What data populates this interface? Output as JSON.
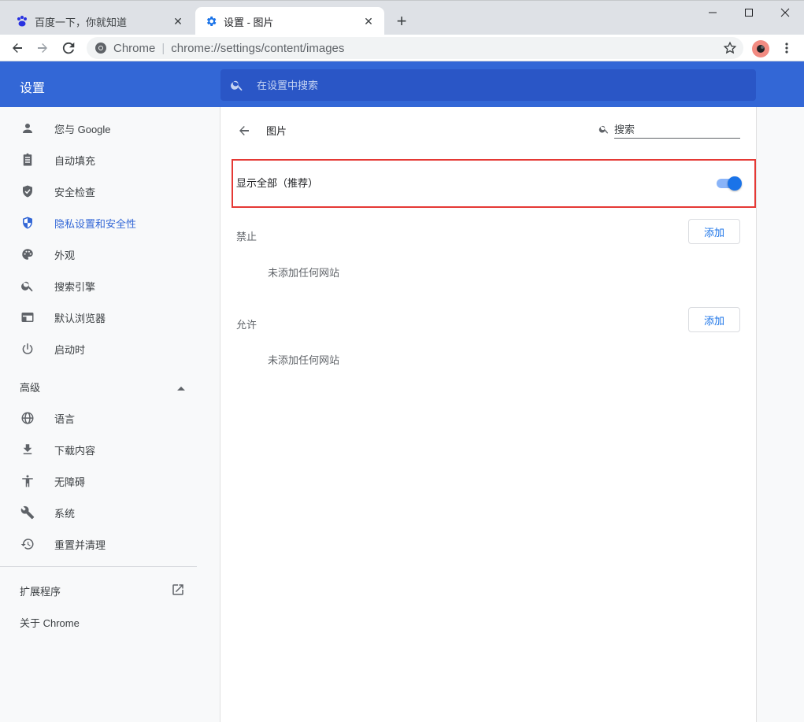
{
  "tabs": [
    {
      "title": "百度一下，你就知道",
      "close": "✕"
    },
    {
      "title": "设置 - 图片",
      "close": "✕"
    }
  ],
  "new_tab": "+",
  "omnibox": {
    "site": "Chrome",
    "separator": "|",
    "url": "chrome://settings/content/images"
  },
  "header": {
    "title": "设置",
    "search_placeholder": "在设置中搜索"
  },
  "sidebar": {
    "items": [
      {
        "label": "您与 Google",
        "icon": "person-icon"
      },
      {
        "label": "自动填充",
        "icon": "clipboard-icon"
      },
      {
        "label": "安全检查",
        "icon": "shield-check-icon"
      },
      {
        "label": "隐私设置和安全性",
        "icon": "shield-icon",
        "selected": true
      },
      {
        "label": "外观",
        "icon": "palette-icon"
      },
      {
        "label": "搜索引擎",
        "icon": "search-icon"
      },
      {
        "label": "默认浏览器",
        "icon": "browser-icon"
      },
      {
        "label": "启动时",
        "icon": "power-icon"
      }
    ],
    "advanced_label": "高级",
    "advanced_items": [
      {
        "label": "语言",
        "icon": "globe-icon"
      },
      {
        "label": "下载内容",
        "icon": "download-icon"
      },
      {
        "label": "无障碍",
        "icon": "accessibility-icon"
      },
      {
        "label": "系统",
        "icon": "wrench-icon"
      },
      {
        "label": "重置并清理",
        "icon": "history-icon"
      }
    ],
    "extensions_label": "扩展程序",
    "about_label": "关于 Chrome"
  },
  "page": {
    "title": "图片",
    "search_placeholder": "搜索",
    "toggle_label": "显示全部（推荐）",
    "toggle_on": true,
    "blocked": {
      "title": "禁止",
      "add_label": "添加",
      "empty": "未添加任何网站"
    },
    "allowed": {
      "title": "允许",
      "add_label": "添加",
      "empty": "未添加任何网站"
    }
  },
  "colors": {
    "header_blue": "#3367d6",
    "accent": "#1a73e8",
    "highlight_red": "#e53935"
  }
}
